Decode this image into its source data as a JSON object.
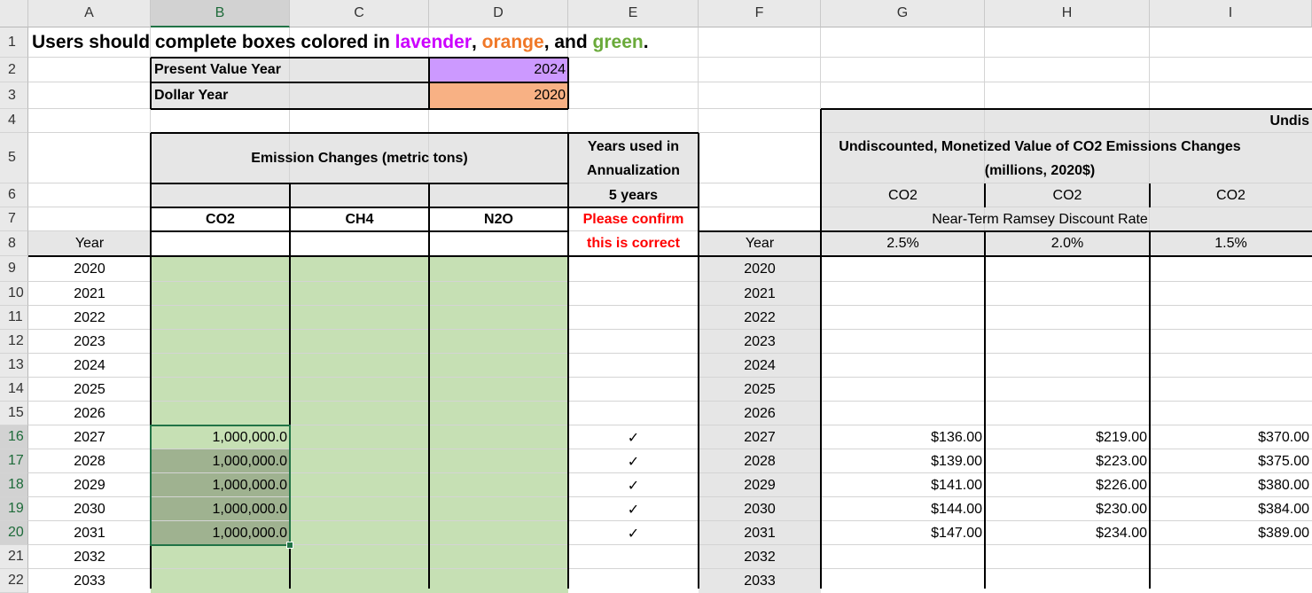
{
  "columns": [
    "A",
    "B",
    "C",
    "D",
    "E",
    "F",
    "G",
    "H",
    "I"
  ],
  "rows": [
    "1",
    "2",
    "3",
    "4",
    "5",
    "6",
    "7",
    "8",
    "9",
    "10",
    "11",
    "12",
    "13",
    "14",
    "15",
    "16",
    "17",
    "18",
    "19",
    "20",
    "21",
    "22"
  ],
  "instruction": {
    "prefix": "Users should complete boxes colored in ",
    "lavender": "lavender",
    "sep1": ", ",
    "orange": "orange",
    "sep2": ", and ",
    "green": "green",
    "end": "."
  },
  "colors": {
    "lavender_word": "#cc00ff",
    "orange_word": "#f07828",
    "green_word": "#6aaa3a",
    "lavender_fill": "#cc99ff",
    "orange_fill": "#f8b184",
    "green_fill": "#c6e0b4"
  },
  "present_value_year": {
    "label": "Present Value Year",
    "value": "2024"
  },
  "dollar_year": {
    "label": "Dollar Year",
    "value": "2020"
  },
  "emission": {
    "header": "Emission Changes (metric tons)",
    "co2": "CO2",
    "ch4": "CH4",
    "n2o": "N2O",
    "year": "Year"
  },
  "annualization": {
    "line1": "Years used in",
    "line2": "Annualization",
    "years": "5 years",
    "warn1": "Please confirm",
    "warn2": "this is correct"
  },
  "right": {
    "year": "Year",
    "top": "Undis",
    "title1": "Undiscounted, Monetized Value of CO2 Emissions Changes",
    "title2": "(millions, 2020$)",
    "gases": [
      "CO2",
      "CO2",
      "CO2"
    ],
    "rate_label": "Near-Term Ramsey Discount Rate",
    "rates": [
      "2.5%",
      "2.0%",
      "1.5%"
    ]
  },
  "years": [
    "2020",
    "2021",
    "2022",
    "2023",
    "2024",
    "2025",
    "2026",
    "2027",
    "2028",
    "2029",
    "2030",
    "2031",
    "2032",
    "2033"
  ],
  "co2": [
    "",
    "",
    "",
    "",
    "",
    "",
    "",
    "1,000,000.0",
    "1,000,000.0",
    "1,000,000.0",
    "1,000,000.0",
    "1,000,000.0",
    "",
    ""
  ],
  "checks": [
    "",
    "",
    "",
    "",
    "",
    "",
    "",
    "✓",
    "✓",
    "✓",
    "✓",
    "✓",
    "",
    ""
  ],
  "g": [
    "",
    "",
    "",
    "",
    "",
    "",
    "",
    "$136.00",
    "$139.00",
    "$141.00",
    "$144.00",
    "$147.00",
    "",
    ""
  ],
  "h": [
    "",
    "",
    "",
    "",
    "",
    "",
    "",
    "$219.00",
    "$223.00",
    "$226.00",
    "$230.00",
    "$234.00",
    "",
    ""
  ],
  "i": [
    "",
    "",
    "",
    "",
    "",
    "",
    "",
    "$370.00",
    "$375.00",
    "$380.00",
    "$384.00",
    "$389.00",
    "",
    ""
  ]
}
